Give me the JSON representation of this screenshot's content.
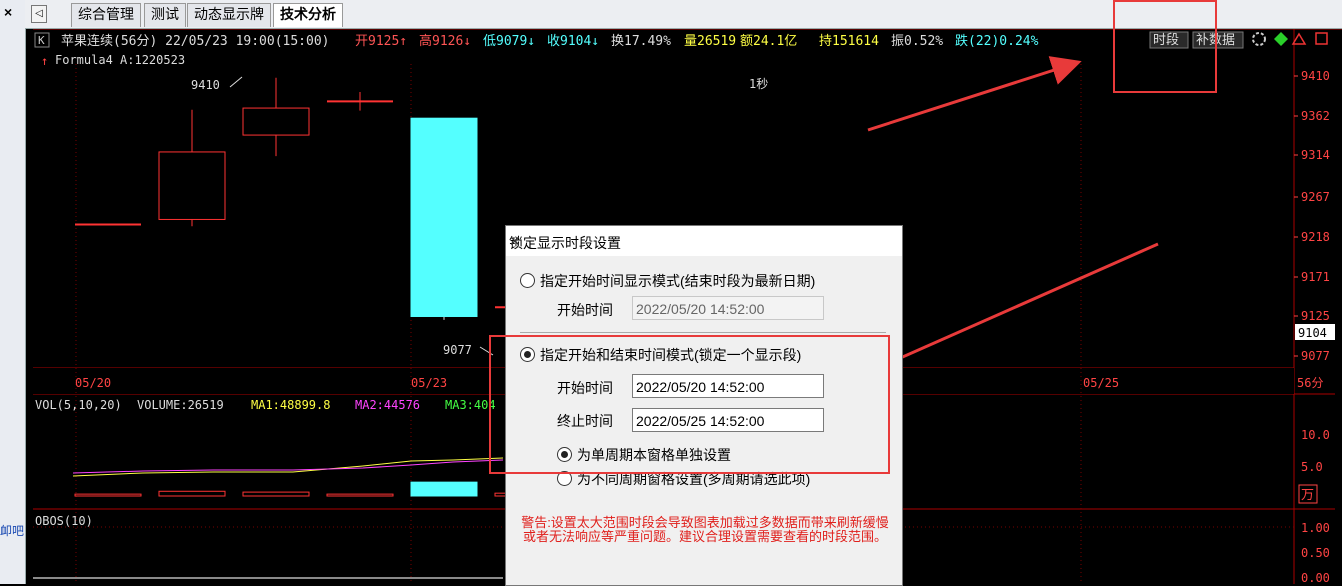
{
  "left_strip": {
    "close_glyph": "×",
    "fragment_text": "卹吧"
  },
  "tabs": {
    "nav_glyph": "◁",
    "items": [
      {
        "label": "综合管理"
      },
      {
        "label": "测试"
      },
      {
        "label": "动态显示牌"
      },
      {
        "label": "技术分析"
      }
    ]
  },
  "header": {
    "k_badge": "K",
    "text": "苹果连续(56分) 22/05/23 19:00(15:00)",
    "open": "开9125↑",
    "high": "高9126↓",
    "low": "低9079↓",
    "close": "收9104↓",
    "turnover": "换17.49%",
    "volume": "量26519",
    "amount": "额24.1亿",
    "hold": "持151614",
    "amplitude": "振0.52%",
    "change": "跌(22)0.24%",
    "btn_period": "时段",
    "btn_fill": "补数据"
  },
  "formula_line": {
    "arrow": "↑",
    "text": "Formula4 A:1220523"
  },
  "chart_data": {
    "type": "candlestick",
    "timeframe": "56分",
    "date_labels": [
      "05/20",
      "05/23",
      "05/25"
    ],
    "price_axis_ticks": [
      "9410",
      "9362",
      "9314",
      "9267",
      "9218",
      "9171",
      "9125",
      "9077"
    ],
    "current_price_label": "9104",
    "annotations": {
      "high": "9410",
      "low": "9077",
      "tick_text": "1秒"
    },
    "candles": [
      {
        "open": 9234,
        "high": 9234,
        "low": 9234,
        "close": 9234
      },
      {
        "open": 9240,
        "high": 9370,
        "low": 9232,
        "close": 9320
      },
      {
        "open": 9340,
        "high": 9408,
        "low": 9315,
        "close": 9372
      },
      {
        "open": 9380,
        "high": 9391,
        "low": 9369,
        "close": 9380
      },
      {
        "open": 9360,
        "high": 9360,
        "low": 9121,
        "close": 9125,
        "highlight": true
      },
      {
        "open": 9136,
        "high": 9146,
        "low": 9110,
        "close": 9136
      }
    ],
    "volume_panel": {
      "title": "VOL(5,10,20)",
      "volume": "VOLUME:26519",
      "ma1": "MA1:48899.8",
      "ma2": "MA2:44576",
      "ma3": "MA3:404",
      "axis_ticks": [
        "10.0",
        "5.0"
      ],
      "unit": "万",
      "bars": [
        0.3,
        0.75,
        0.62,
        0.3,
        2.2,
        0.45
      ]
    },
    "obos_panel": {
      "title": "OBOS(10)",
      "axis_ticks": [
        "1.00",
        "0.50",
        "0.00"
      ]
    }
  },
  "dialog": {
    "title": "锁定显示时段设置",
    "mode1": {
      "label": "指定开始时间显示模式(结束时段为最新日期)",
      "start_label": "开始时间",
      "start_value": "2022/05/20 14:52:00"
    },
    "mode2": {
      "label": "指定开始和结束时间模式(锁定一个显示段)",
      "start_label": "开始时间",
      "start_value": "2022/05/20 14:52:00",
      "end_label": "终止时间",
      "end_value": "2022/05/25 14:52:00"
    },
    "sub1": "为单周期本窗格单独设置",
    "sub2": "为不同周期窗格设置(多周期请选此项)",
    "warning": "警告:设置太大范围时段会导致图表加载过多数据而带来刷新缓慢或者无法响应等严重问题。建议合理设置需要查看的时段范围。"
  },
  "colors": {
    "up": "#ff3333",
    "down_highlight": "#54ffff",
    "accent_red": "#e83a3a",
    "ma1": "#ffff44",
    "ma2": "#ff44ff",
    "ma3": "#44ff44"
  }
}
